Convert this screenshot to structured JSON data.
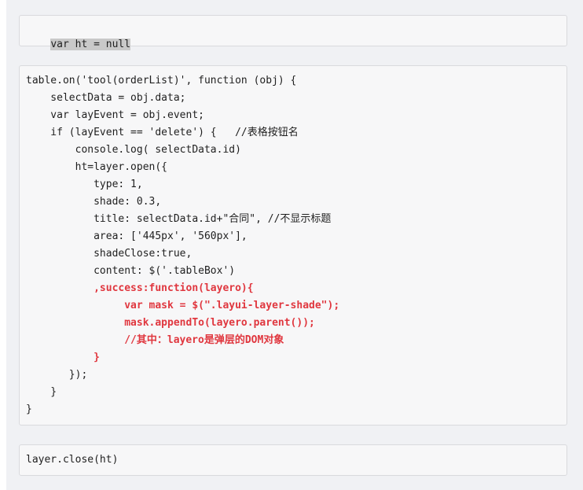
{
  "snippets": {
    "first": "var ht = null",
    "main": [
      {
        "text": "table.on('tool(orderList)', function (obj) {",
        "red": false
      },
      {
        "text": "    selectData = obj.data;",
        "red": false
      },
      {
        "text": "    var layEvent = obj.event;",
        "red": false
      },
      {
        "text": "    if (layEvent == 'delete') {   //表格按钮名",
        "red": false
      },
      {
        "text": "        console.log( selectData.id)",
        "red": false
      },
      {
        "text": "        ht=layer.open({",
        "red": false
      },
      {
        "text": "           type: 1,",
        "red": false
      },
      {
        "text": "           shade: 0.3,",
        "red": false
      },
      {
        "text": "           title: selectData.id+\"合同\", //不显示标题",
        "red": false
      },
      {
        "text": "           area: ['445px', '560px'],",
        "red": false
      },
      {
        "text": "           shadeClose:true,",
        "red": false
      },
      {
        "text": "           content: $('.tableBox')",
        "red": false
      },
      {
        "text": "           ,success:function(layero){",
        "red": true
      },
      {
        "text": "                var mask = $(\".layui-layer-shade\");",
        "red": true
      },
      {
        "text": "                mask.appendTo(layero.parent());",
        "red": true
      },
      {
        "text": "                //其中：layero是弹层的DOM对象",
        "red": true
      },
      {
        "text": "           }",
        "red": true
      },
      {
        "text": "       });",
        "red": false
      },
      {
        "text": "    }",
        "red": false
      },
      {
        "text": "}",
        "red": false
      }
    ],
    "last": "layer.close(ht)"
  }
}
